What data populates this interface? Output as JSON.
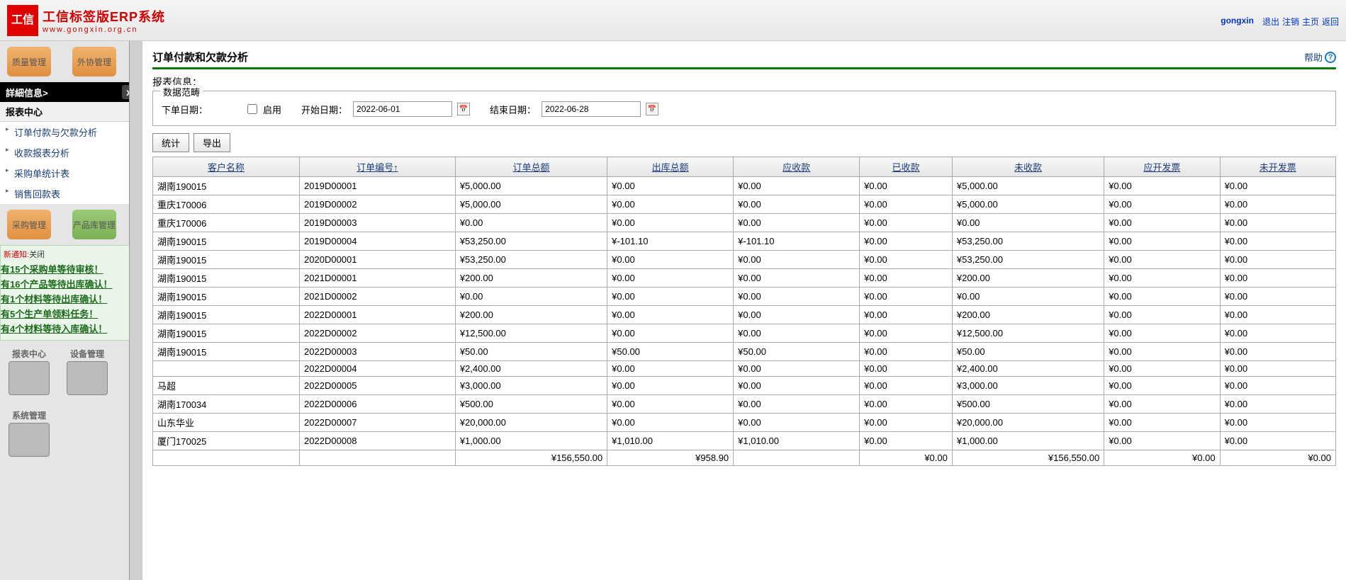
{
  "header": {
    "logo_chars": "工信",
    "title": "工信标签版ERP系统",
    "url": "www.gongxin.org.cn",
    "username": "gongxin",
    "links": [
      "退出",
      "注销",
      "主页",
      "返回"
    ]
  },
  "sidebar": {
    "top_tiles": [
      {
        "label": "质量管理",
        "cls": "tile-orange"
      },
      {
        "label": "外协管理",
        "cls": "tile-orange"
      }
    ],
    "detail_title": "詳細信息>",
    "section_title": "报表中心",
    "menu": [
      "订单付款与欠款分析",
      "收款报表分析",
      "采购单统计表",
      "销售回款表"
    ],
    "mid_tiles": [
      {
        "label": "采购管理",
        "cls": "tile-orange"
      },
      {
        "label": "产品库管理",
        "cls": "tile-green"
      }
    ],
    "notify": {
      "title": "新通知:",
      "close": "关闭",
      "lines": [
        "有15个采购单等待审核！",
        "有16个产品等待出库确认！",
        "有1个材料等待出库确认！",
        "有5个生产单领料任务！",
        "有4个材料等待入库确认！"
      ]
    },
    "bottom_tiles": [
      {
        "label": "报表中心"
      },
      {
        "label": "设备管理"
      },
      {
        "label": "系统管理"
      }
    ]
  },
  "main": {
    "title": "订单付款和欠款分析",
    "help": "帮助",
    "report_info_label": "报表信息：",
    "fieldset_legend": "数据范畴",
    "filters": {
      "order_date_label": "下单日期：",
      "enable_label": "启用",
      "start_label": "开始日期：",
      "start_value": "2022-06-01",
      "end_label": "结束日期：",
      "end_value": "2022-06-28"
    },
    "buttons": {
      "stat": "统计",
      "export": "导出"
    },
    "columns": [
      "客户名称",
      "订单编号↑",
      "订单总额",
      "出库总额",
      "应收款",
      "已收款",
      "未收款",
      "应开发票",
      "未开发票"
    ],
    "rows": [
      [
        "湖南190015",
        "2019D00001",
        "¥5,000.00",
        "¥0.00",
        "¥0.00",
        "¥0.00",
        "¥5,000.00",
        "¥0.00",
        "¥0.00"
      ],
      [
        "重庆170006",
        "2019D00002",
        "¥5,000.00",
        "¥0.00",
        "¥0.00",
        "¥0.00",
        "¥5,000.00",
        "¥0.00",
        "¥0.00"
      ],
      [
        "重庆170006",
        "2019D00003",
        "¥0.00",
        "¥0.00",
        "¥0.00",
        "¥0.00",
        "¥0.00",
        "¥0.00",
        "¥0.00"
      ],
      [
        "湖南190015",
        "2019D00004",
        "¥53,250.00",
        "¥-101.10",
        "¥-101.10",
        "¥0.00",
        "¥53,250.00",
        "¥0.00",
        "¥0.00"
      ],
      [
        "湖南190015",
        "2020D00001",
        "¥53,250.00",
        "¥0.00",
        "¥0.00",
        "¥0.00",
        "¥53,250.00",
        "¥0.00",
        "¥0.00"
      ],
      [
        "湖南190015",
        "2021D00001",
        "¥200.00",
        "¥0.00",
        "¥0.00",
        "¥0.00",
        "¥200.00",
        "¥0.00",
        "¥0.00"
      ],
      [
        "湖南190015",
        "2021D00002",
        "¥0.00",
        "¥0.00",
        "¥0.00",
        "¥0.00",
        "¥0.00",
        "¥0.00",
        "¥0.00"
      ],
      [
        "湖南190015",
        "2022D00001",
        "¥200.00",
        "¥0.00",
        "¥0.00",
        "¥0.00",
        "¥200.00",
        "¥0.00",
        "¥0.00"
      ],
      [
        "湖南190015",
        "2022D00002",
        "¥12,500.00",
        "¥0.00",
        "¥0.00",
        "¥0.00",
        "¥12,500.00",
        "¥0.00",
        "¥0.00"
      ],
      [
        "湖南190015",
        "2022D00003",
        "¥50.00",
        "¥50.00",
        "¥50.00",
        "¥0.00",
        "¥50.00",
        "¥0.00",
        "¥0.00"
      ],
      [
        "",
        "2022D00004",
        "¥2,400.00",
        "¥0.00",
        "¥0.00",
        "¥0.00",
        "¥2,400.00",
        "¥0.00",
        "¥0.00"
      ],
      [
        "马超",
        "2022D00005",
        "¥3,000.00",
        "¥0.00",
        "¥0.00",
        "¥0.00",
        "¥3,000.00",
        "¥0.00",
        "¥0.00"
      ],
      [
        "湖南170034",
        "2022D00006",
        "¥500.00",
        "¥0.00",
        "¥0.00",
        "¥0.00",
        "¥500.00",
        "¥0.00",
        "¥0.00"
      ],
      [
        "山东华业",
        "2022D00007",
        "¥20,000.00",
        "¥0.00",
        "¥0.00",
        "¥0.00",
        "¥20,000.00",
        "¥0.00",
        "¥0.00"
      ],
      [
        "厦门170025",
        "2022D00008",
        "¥1,000.00",
        "¥1,010.00",
        "¥1,010.00",
        "¥0.00",
        "¥1,000.00",
        "¥0.00",
        "¥0.00"
      ]
    ],
    "footer": [
      "",
      "",
      "¥156,550.00",
      "¥958.90",
      "",
      "¥0.00",
      "¥156,550.00",
      "¥0.00",
      "¥0.00"
    ]
  }
}
